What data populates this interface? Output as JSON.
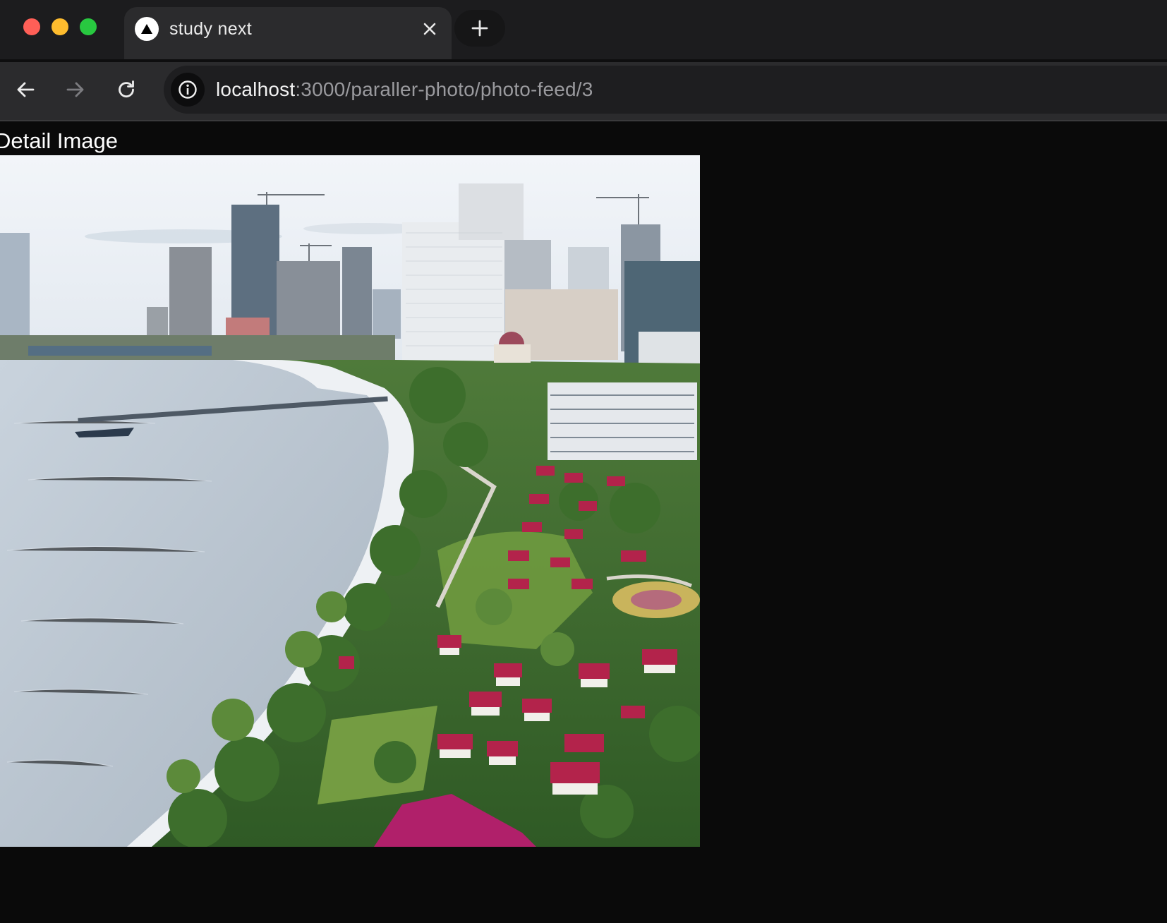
{
  "window": {
    "controls": {
      "close_color": "#ff5f57",
      "minimize_color": "#febc2e",
      "maximize_color": "#28c840"
    }
  },
  "tab": {
    "title": "study next",
    "favicon_icon": "triangle-logo-icon",
    "close_icon": "close-icon"
  },
  "new_tab_icon": "plus-icon",
  "toolbar": {
    "back_icon": "arrow-left-icon",
    "forward_icon": "arrow-right-icon",
    "reload_icon": "reload-icon",
    "site_info_icon": "info-icon",
    "url_host": "localhost",
    "url_path": ":3000/paraller-photo/photo-feed/3"
  },
  "page": {
    "heading": "Detail Image",
    "image_subject": "aerial-coastal-resort-city"
  }
}
